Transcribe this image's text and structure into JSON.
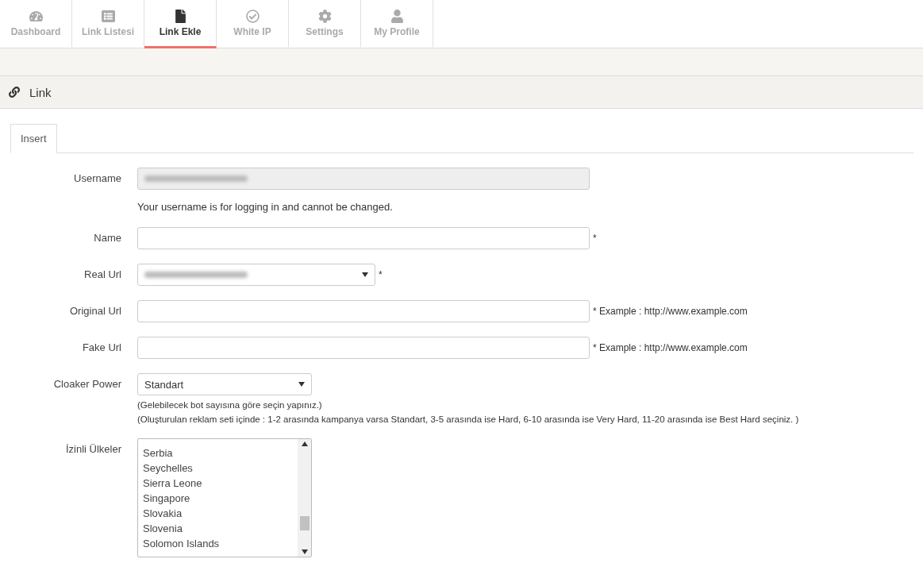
{
  "nav_tabs": [
    {
      "label": "Dashboard",
      "selected": false
    },
    {
      "label": "Link Listesi",
      "selected": false
    },
    {
      "label": "Link Ekle",
      "selected": true
    },
    {
      "label": "White IP",
      "selected": false
    },
    {
      "label": "Settings",
      "selected": false
    },
    {
      "label": "My Profile",
      "selected": false
    }
  ],
  "section_title": "Link",
  "form_tabs": [
    {
      "label": "Insert",
      "selected": true
    }
  ],
  "fields": [
    {
      "kind": "text",
      "label": "Username",
      "disabled": true,
      "blurred": true,
      "help": [
        "Your username is for logging in and cannot be changed."
      ]
    },
    {
      "kind": "text",
      "label": "Name",
      "disabled": false,
      "required": "*"
    },
    {
      "kind": "select",
      "label": "Real Url",
      "blurred": true,
      "required": "*"
    },
    {
      "kind": "text",
      "label": "Original Url",
      "disabled": false,
      "required": "* Example : http://www.example.com"
    },
    {
      "kind": "text",
      "label": "Fake Url",
      "disabled": false,
      "required": "* Example : http://www.example.com"
    },
    {
      "kind": "select",
      "label": "Cloaker Power",
      "value": "Standart",
      "help": [
        "(Gelebilecek bot sayısına göre seçin yapınız.)",
        "(Oluşturulan reklam seti içinde : 1-2 arasında kampanya varsa Standart, 3-5 arasında ise Hard, 6-10 arasında ise Very Hard, 11-20 arasında ise Best Hard seçiniz. )"
      ]
    },
    {
      "kind": "listbox",
      "label": "İzinli Ülkeler",
      "options": [
        "Serbia",
        "Seychelles",
        "Sierra Leone",
        "Singapore",
        "Slovakia",
        "Slovenia",
        "Solomon Islands"
      ]
    }
  ]
}
